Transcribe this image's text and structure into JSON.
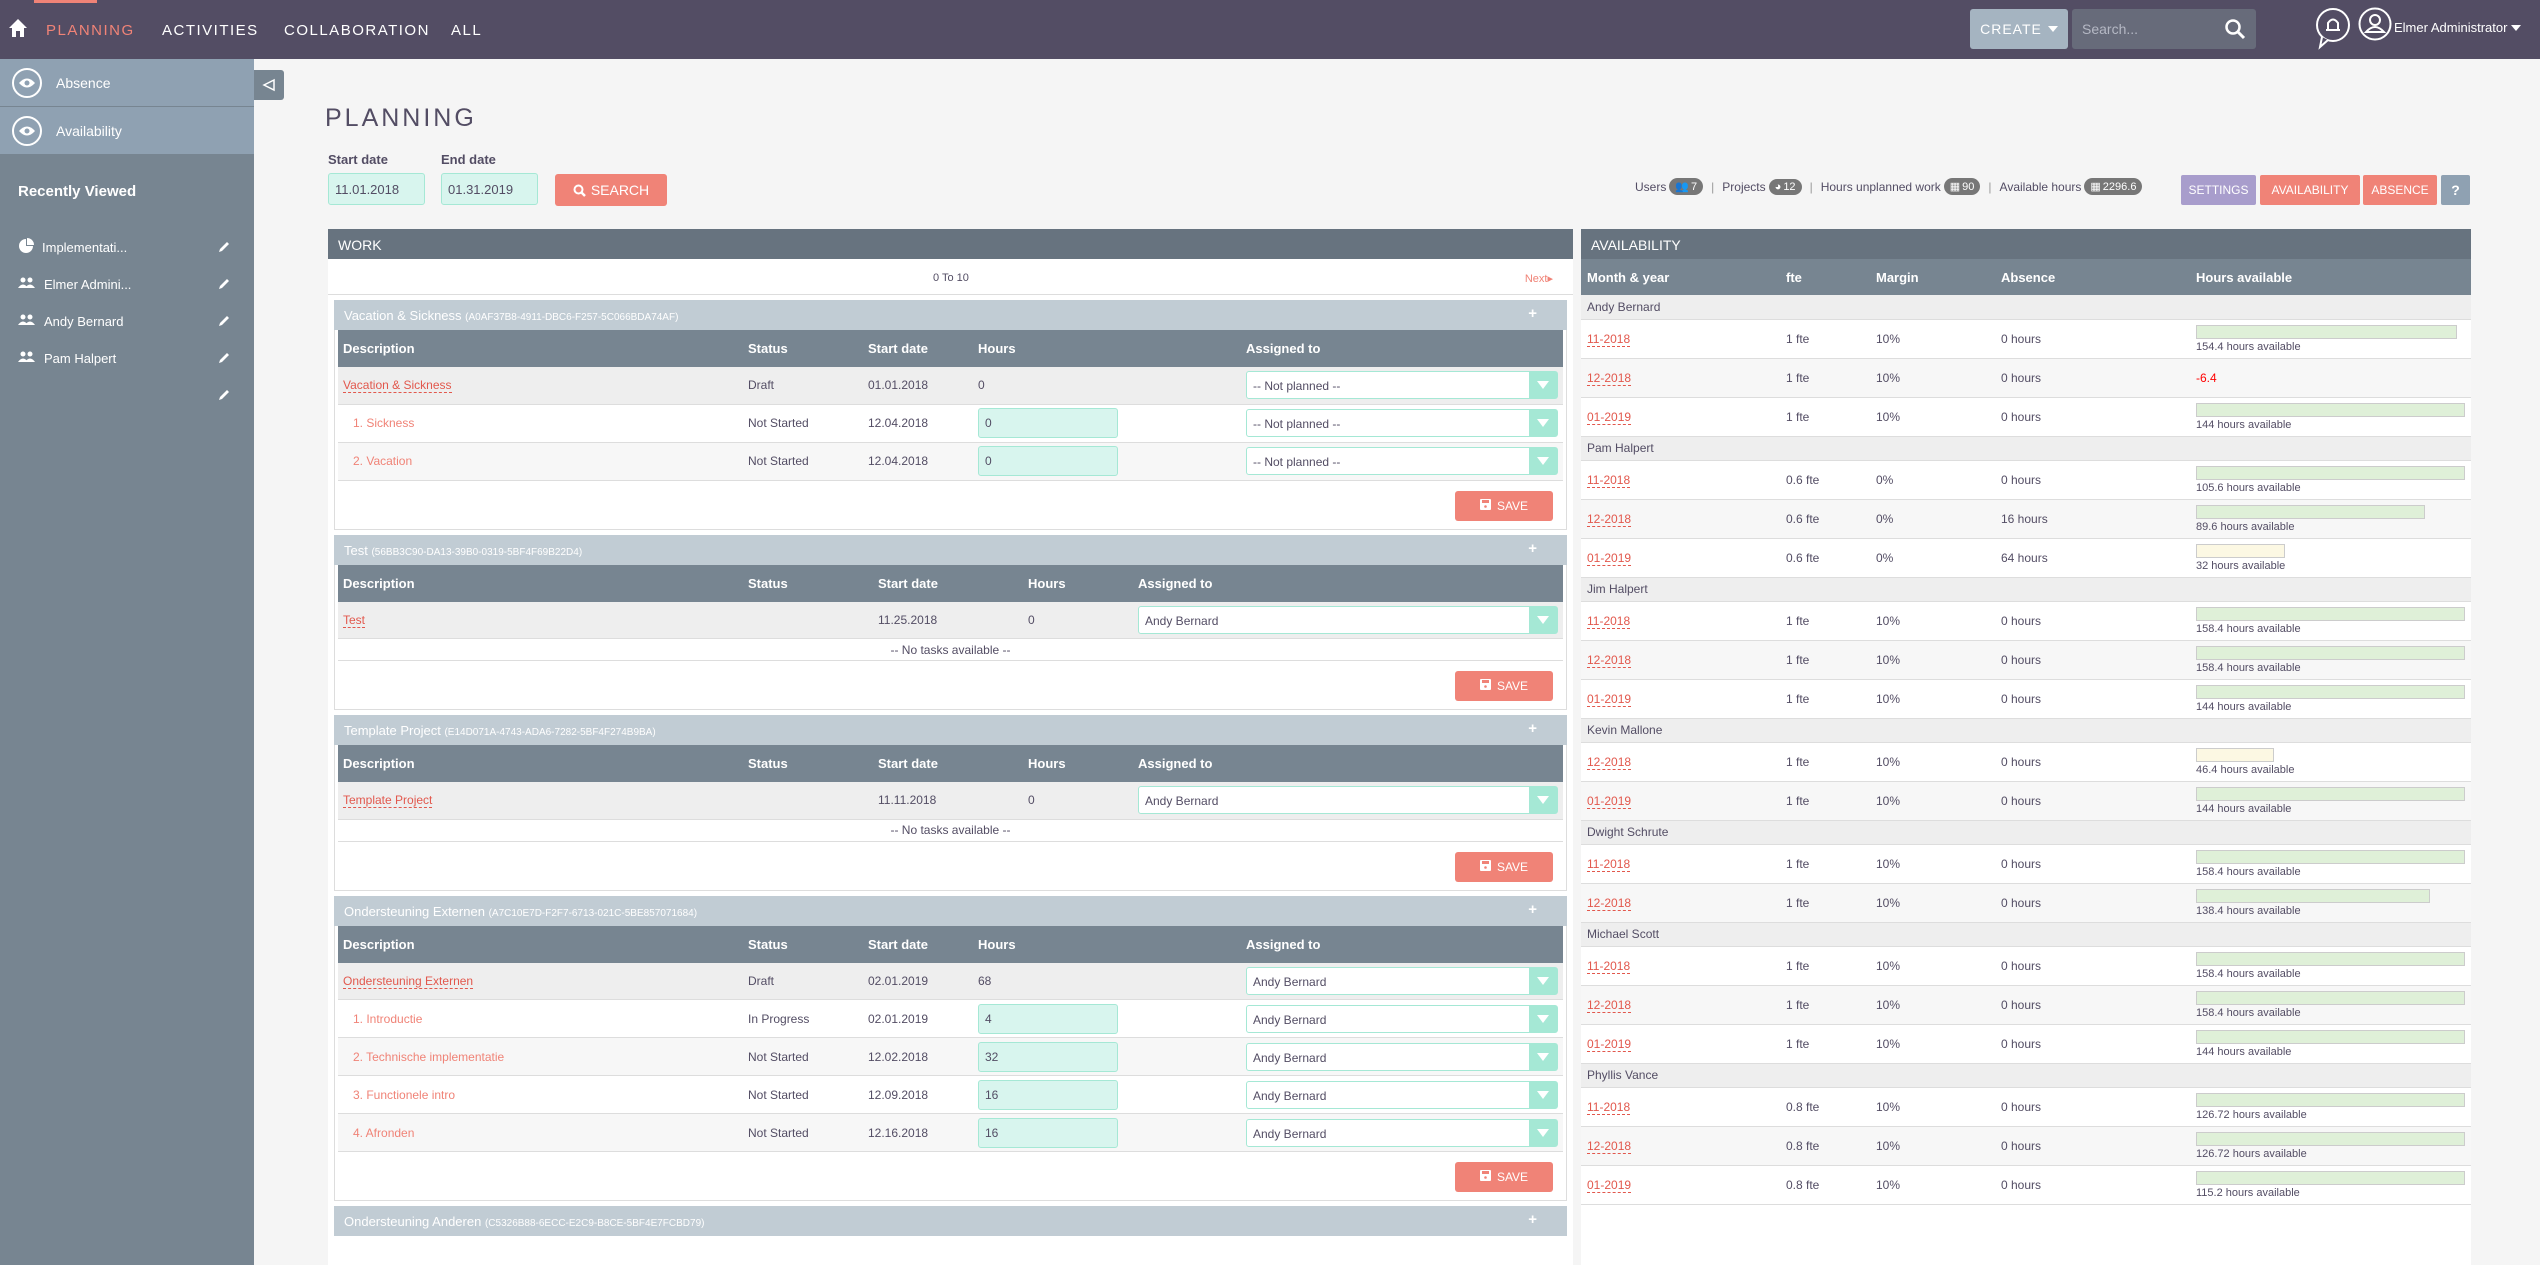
{
  "nav": {
    "items": [
      {
        "label": "PLANNING",
        "active": true
      },
      {
        "label": "ACTIVITIES",
        "active": false
      },
      {
        "label": "COLLABORATION",
        "active": false
      },
      {
        "label": "ALL",
        "active": false
      }
    ],
    "create_label": "CREATE",
    "search_placeholder": "Search...",
    "user_name": "Elmer Administrator"
  },
  "sidebar": {
    "actions": [
      {
        "label": "Absence",
        "icon": "eye-icon"
      },
      {
        "label": "Availability",
        "icon": "eye-icon"
      }
    ],
    "recent_title": "Recently Viewed",
    "recent": [
      {
        "label": "Implementati...",
        "icon": "pie-chart-icon"
      },
      {
        "label": "Elmer Admini...",
        "icon": "users-icon"
      },
      {
        "label": "Andy Bernard",
        "icon": "users-icon"
      },
      {
        "label": "Pam Halpert",
        "icon": "users-icon"
      },
      {
        "label": "",
        "icon": ""
      }
    ]
  },
  "page": {
    "title": "PLANNING",
    "start_label": "Start date",
    "start_value": "11.01.2018",
    "end_label": "End date",
    "end_value": "01.31.2019",
    "search_label": "SEARCH"
  },
  "stats": {
    "users_label": "Users",
    "users": "7",
    "projects_label": "Projects",
    "projects": "12",
    "unplanned_label": "Hours unplanned work",
    "unplanned": "90",
    "available_label": "Available hours",
    "available": "2296.6"
  },
  "buttons": {
    "settings": "SETTINGS",
    "availability": "AVAILABILITY",
    "absence": "ABSENCE",
    "help": "?"
  },
  "colors": {
    "accent": "#f08377",
    "nav": "#534d64",
    "settings": "#a89dcc",
    "help": "#8fa1b2",
    "input_bg": "#d8f5ee"
  },
  "work": {
    "title": "WORK",
    "range": "0 To 10",
    "next": "Next",
    "columns": [
      "Description",
      "Status",
      "Start date",
      "Hours",
      "Assigned to"
    ],
    "save_label": "SAVE",
    "no_tasks": "-- No tasks available --",
    "projects": [
      {
        "name": "Vacation & Sickness",
        "id": "(A0AF37B8-4911-DBC6-F257-5C066BDA74AF)",
        "parent": {
          "desc": "Vacation & Sickness",
          "status": "Draft",
          "start": "01.01.2018",
          "hours": "0",
          "assigned": "-- Not planned --"
        },
        "tasks": [
          {
            "desc": "1. Sickness",
            "status": "Not Started",
            "start": "12.04.2018",
            "hours": "0",
            "assigned": "-- Not planned --"
          },
          {
            "desc": "2. Vacation",
            "status": "Not Started",
            "start": "12.04.2018",
            "hours": "0",
            "assigned": "-- Not planned --"
          }
        ]
      },
      {
        "name": "Test",
        "id": "(56BB3C90-DA13-39B0-0319-5BF4F69B22D4)",
        "parent": {
          "desc": "Test",
          "status": "",
          "start": "11.25.2018",
          "hours": "0",
          "assigned": "Andy Bernard"
        },
        "tasks": []
      },
      {
        "name": "Template Project",
        "id": "(E14D071A-4743-ADA6-7282-5BF4F274B9BA)",
        "parent": {
          "desc": "Template Project",
          "status": "",
          "start": "11.11.2018",
          "hours": "0",
          "assigned": "Andy Bernard"
        },
        "tasks": []
      },
      {
        "name": "Ondersteuning Externen",
        "id": "(A7C10E7D-F2F7-6713-021C-5BE857071684)",
        "parent": {
          "desc": "Ondersteuning Externen",
          "status": "Draft",
          "start": "02.01.2019",
          "hours": "68",
          "assigned": "Andy Bernard"
        },
        "tasks": [
          {
            "desc": "1. Introductie",
            "status": "In Progress",
            "start": "02.01.2019",
            "hours": "4",
            "assigned": "Andy Bernard"
          },
          {
            "desc": "2. Technische implementatie",
            "status": "Not Started",
            "start": "12.02.2018",
            "hours": "32",
            "assigned": "Andy Bernard"
          },
          {
            "desc": "3. Functionele intro",
            "status": "Not Started",
            "start": "12.09.2018",
            "hours": "16",
            "assigned": "Andy Bernard"
          },
          {
            "desc": "4. Afronden",
            "status": "Not Started",
            "start": "12.16.2018",
            "hours": "16",
            "assigned": "Andy Bernard"
          }
        ]
      },
      {
        "name": "Ondersteuning Anderen",
        "id": "(C5326B88-6ECC-E2C9-B8CE-5BF4E7FCBD79)",
        "collapsed": true
      }
    ]
  },
  "availability": {
    "title": "AVAILABILITY",
    "columns": [
      "Month & year",
      "fte",
      "Margin",
      "Absence",
      "Hours available"
    ],
    "people": [
      {
        "name": "Andy Bernard",
        "rows": [
          {
            "month": "11-2018",
            "fte": "1 fte",
            "margin": "10%",
            "absence": "0 hours",
            "hours": "154.4 hours available",
            "fill": 0.97,
            "color": "green"
          },
          {
            "month": "12-2018",
            "fte": "1 fte",
            "margin": "10%",
            "absence": "0 hours",
            "hours": "-6.4",
            "negative": true
          },
          {
            "month": "01-2019",
            "fte": "1 fte",
            "margin": "10%",
            "absence": "0 hours",
            "hours": "144 hours available",
            "fill": 1.0,
            "color": "green"
          }
        ]
      },
      {
        "name": "Pam Halpert",
        "rows": [
          {
            "month": "11-2018",
            "fte": "0.6 fte",
            "margin": "0%",
            "absence": "0 hours",
            "hours": "105.6 hours available",
            "fill": 1.0,
            "color": "green"
          },
          {
            "month": "12-2018",
            "fte": "0.6 fte",
            "margin": "0%",
            "absence": "16 hours",
            "hours": "89.6 hours available",
            "fill": 0.85,
            "color": "green"
          },
          {
            "month": "01-2019",
            "fte": "0.6 fte",
            "margin": "0%",
            "absence": "64 hours",
            "hours": "32 hours available",
            "fill": 0.33,
            "color": "yellow"
          }
        ]
      },
      {
        "name": "Jim Halpert",
        "rows": [
          {
            "month": "11-2018",
            "fte": "1 fte",
            "margin": "10%",
            "absence": "0 hours",
            "hours": "158.4 hours available",
            "fill": 1.0,
            "color": "green"
          },
          {
            "month": "12-2018",
            "fte": "1 fte",
            "margin": "10%",
            "absence": "0 hours",
            "hours": "158.4 hours available",
            "fill": 1.0,
            "color": "green"
          },
          {
            "month": "01-2019",
            "fte": "1 fte",
            "margin": "10%",
            "absence": "0 hours",
            "hours": "144 hours available",
            "fill": 1.0,
            "color": "green"
          }
        ]
      },
      {
        "name": "Kevin Mallone",
        "rows": [
          {
            "month": "12-2018",
            "fte": "1 fte",
            "margin": "10%",
            "absence": "0 hours",
            "hours": "46.4 hours available",
            "fill": 0.29,
            "color": "yellow"
          },
          {
            "month": "01-2019",
            "fte": "1 fte",
            "margin": "10%",
            "absence": "0 hours",
            "hours": "144 hours available",
            "fill": 1.0,
            "color": "green"
          }
        ]
      },
      {
        "name": "Dwight Schrute",
        "rows": [
          {
            "month": "11-2018",
            "fte": "1 fte",
            "margin": "10%",
            "absence": "0 hours",
            "hours": "158.4 hours available",
            "fill": 1.0,
            "color": "green"
          },
          {
            "month": "12-2018",
            "fte": "1 fte",
            "margin": "10%",
            "absence": "0 hours",
            "hours": "138.4 hours available",
            "fill": 0.87,
            "color": "green"
          }
        ]
      },
      {
        "name": "Michael Scott",
        "rows": [
          {
            "month": "11-2018",
            "fte": "1 fte",
            "margin": "10%",
            "absence": "0 hours",
            "hours": "158.4 hours available",
            "fill": 1.0,
            "color": "green"
          },
          {
            "month": "12-2018",
            "fte": "1 fte",
            "margin": "10%",
            "absence": "0 hours",
            "hours": "158.4 hours available",
            "fill": 1.0,
            "color": "green"
          },
          {
            "month": "01-2019",
            "fte": "1 fte",
            "margin": "10%",
            "absence": "0 hours",
            "hours": "144 hours available",
            "fill": 1.0,
            "color": "green"
          }
        ]
      },
      {
        "name": "Phyllis Vance",
        "rows": [
          {
            "month": "11-2018",
            "fte": "0.8 fte",
            "margin": "10%",
            "absence": "0 hours",
            "hours": "126.72 hours available",
            "fill": 1.0,
            "color": "green"
          },
          {
            "month": "12-2018",
            "fte": "0.8 fte",
            "margin": "10%",
            "absence": "0 hours",
            "hours": "126.72 hours available",
            "fill": 1.0,
            "color": "green"
          },
          {
            "month": "01-2019",
            "fte": "0.8 fte",
            "margin": "10%",
            "absence": "0 hours",
            "hours": "115.2 hours available",
            "fill": 1.0,
            "color": "green"
          }
        ]
      }
    ]
  }
}
